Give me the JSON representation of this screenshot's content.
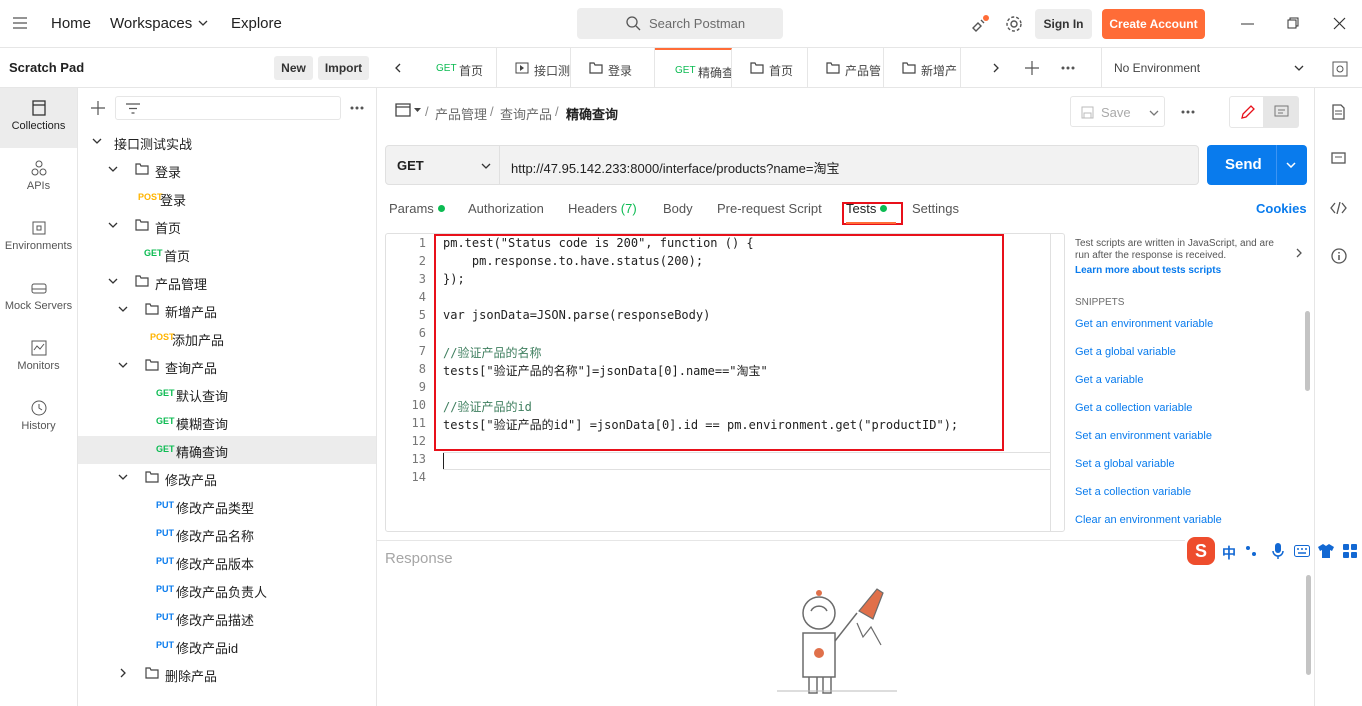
{
  "topbar": {
    "home": "Home",
    "workspaces": "Workspaces",
    "explore": "Explore",
    "search_placeholder": "Search Postman",
    "sign_in": "Sign In",
    "create_account": "Create Account"
  },
  "scratch": {
    "title": "Scratch Pad",
    "new_label": "New",
    "import_label": "Import"
  },
  "rail": [
    {
      "label": "Collections"
    },
    {
      "label": "APIs"
    },
    {
      "label": "Environments"
    },
    {
      "label": "Mock Servers"
    },
    {
      "label": "Monitors"
    },
    {
      "label": "History"
    }
  ],
  "tree": [
    {
      "type": "collection",
      "label": "接口测试实战"
    },
    {
      "type": "folder",
      "label": "登录"
    },
    {
      "type": "request",
      "method": "POST",
      "label": "登录"
    },
    {
      "type": "folder",
      "label": "首页"
    },
    {
      "type": "request",
      "method": "GET",
      "label": "首页"
    },
    {
      "type": "folder",
      "label": "产品管理"
    },
    {
      "type": "folder",
      "label": "新增产品"
    },
    {
      "type": "request",
      "method": "POST",
      "label": "添加产品"
    },
    {
      "type": "folder",
      "label": "查询产品"
    },
    {
      "type": "request",
      "method": "GET",
      "label": "默认查询"
    },
    {
      "type": "request",
      "method": "GET",
      "label": "模糊查询"
    },
    {
      "type": "request",
      "method": "GET",
      "label": "精确查询"
    },
    {
      "type": "folder",
      "label": "修改产品"
    },
    {
      "type": "request",
      "method": "PUT",
      "label": "修改产品类型"
    },
    {
      "type": "request",
      "method": "PUT",
      "label": "修改产品名称"
    },
    {
      "type": "request",
      "method": "PUT",
      "label": "修改产品版本"
    },
    {
      "type": "request",
      "method": "PUT",
      "label": "修改产品负责人"
    },
    {
      "type": "request",
      "method": "PUT",
      "label": "修改产品描述"
    },
    {
      "type": "request",
      "method": "PUT",
      "label": "修改产品id"
    },
    {
      "type": "folder",
      "label": "删除产品"
    }
  ],
  "tabs": [
    {
      "method": "GET",
      "label": "首页"
    },
    {
      "method": "",
      "label": "接口测"
    },
    {
      "method": "",
      "label": "登录"
    },
    {
      "method": "GET",
      "label": "精确查"
    },
    {
      "method": "",
      "label": "首页"
    },
    {
      "method": "",
      "label": "产品管"
    },
    {
      "method": "",
      "label": "新增产"
    }
  ],
  "environment": "No Environment",
  "breadcrumb": {
    "part1": "产品管理",
    "part2": "查询产品",
    "current": "精确查询",
    "save": "Save"
  },
  "request": {
    "method": "GET",
    "url": "http://47.95.142.233:8000/interface/products?name=淘宝",
    "send": "Send"
  },
  "req_tabs": {
    "params": "Params",
    "authorization": "Authorization",
    "headers": "Headers",
    "headers_count": "(7)",
    "body": "Body",
    "prerequest": "Pre-request Script",
    "tests": "Tests",
    "settings": "Settings",
    "cookies": "Cookies"
  },
  "code_lines": [
    "pm.test(\"Status code is 200\", function () {",
    "    pm.response.to.have.status(200);",
    "});",
    "",
    "var jsonData=JSON.parse(responseBody)",
    "",
    "//验证产品的名称",
    "tests[\"验证产品的名称\"]=jsonData[0].name==\"淘宝\"",
    "",
    "//验证产品的id",
    "tests[\"验证产品的id\"] =jsonData[0].id == pm.environment.get(\"productID\");",
    "",
    "",
    ""
  ],
  "snippets_panel": {
    "intro": "Test scripts are written in JavaScript, and are run after the response is received.",
    "learn_more": "Learn more about tests scripts",
    "heading": "SNIPPETS",
    "items": [
      "Get an environment variable",
      "Get a global variable",
      "Get a variable",
      "Get a collection variable",
      "Set an environment variable",
      "Set a global variable",
      "Set a collection variable",
      "Clear an environment variable"
    ]
  },
  "response": {
    "title": "Response"
  },
  "ime": {
    "lang": "中"
  },
  "colors": {
    "accent": "#ff6c37",
    "send": "#097bed",
    "get": "#0cbb52",
    "post": "#ffb400",
    "put": "#097bed",
    "highlight": "#e8101a"
  }
}
